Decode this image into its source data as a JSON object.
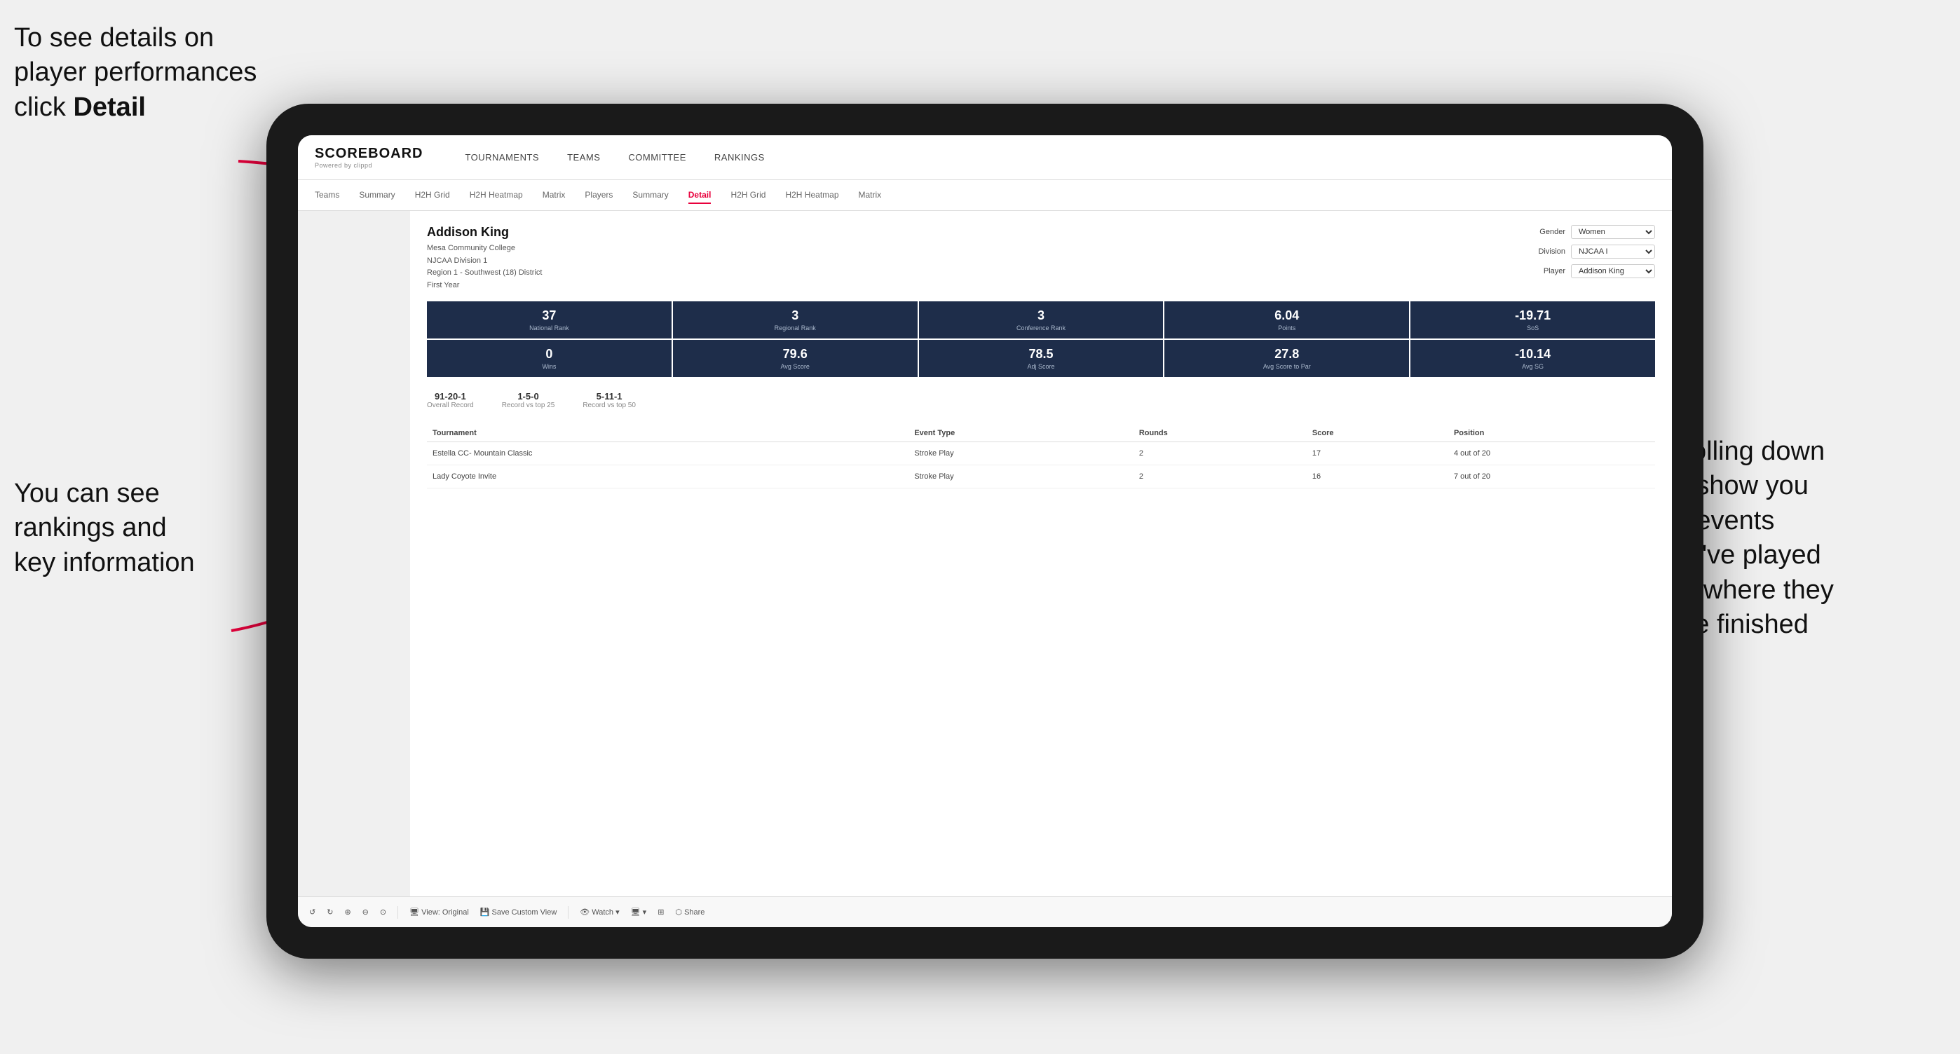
{
  "annotations": {
    "top_left": {
      "line1": "To see details on",
      "line2": "player performances",
      "line3_prefix": "click ",
      "line3_bold": "Detail"
    },
    "bottom_left": {
      "line1": "You can see",
      "line2": "rankings and",
      "line3": "key information"
    },
    "right": {
      "line1": "Scrolling down",
      "line2": "will show you",
      "line3": "the events",
      "line4": "they've played",
      "line5": "and where they",
      "line6": "have finished"
    }
  },
  "nav": {
    "logo": "SCOREBOARD",
    "logo_sub": "Powered by clippd",
    "items": [
      "TOURNAMENTS",
      "TEAMS",
      "COMMITTEE",
      "RANKINGS"
    ]
  },
  "sub_nav": {
    "items": [
      "Teams",
      "Summary",
      "H2H Grid",
      "H2H Heatmap",
      "Matrix",
      "Players",
      "Summary",
      "Detail",
      "H2H Grid",
      "H2H Heatmap",
      "Matrix"
    ],
    "active": "Detail"
  },
  "filters": {
    "gender_label": "Gender",
    "gender_value": "Women",
    "division_label": "Division",
    "division_value": "NJCAA I",
    "player_label": "Player",
    "player_value": "Addison King"
  },
  "player": {
    "name": "Addison King",
    "school": "Mesa Community College",
    "division": "NJCAA Division 1",
    "region": "Region 1 - Southwest (18) District",
    "year": "First Year"
  },
  "stats_row1": [
    {
      "value": "37",
      "label": "National Rank"
    },
    {
      "value": "3",
      "label": "Regional Rank"
    },
    {
      "value": "3",
      "label": "Conference Rank"
    },
    {
      "value": "6.04",
      "label": "Points"
    },
    {
      "value": "-19.71",
      "label": "SoS"
    }
  ],
  "stats_row2": [
    {
      "value": "0",
      "label": "Wins"
    },
    {
      "value": "79.6",
      "label": "Avg Score"
    },
    {
      "value": "78.5",
      "label": "Adj Score"
    },
    {
      "value": "27.8",
      "label": "Avg Score to Par"
    },
    {
      "value": "-10.14",
      "label": "Avg SG"
    }
  ],
  "records": [
    {
      "value": "91-20-1",
      "label": "Overall Record"
    },
    {
      "value": "1-5-0",
      "label": "Record vs top 25"
    },
    {
      "value": "5-11-1",
      "label": "Record vs top 50"
    }
  ],
  "table": {
    "headers": [
      "Tournament",
      "Event Type",
      "Rounds",
      "Score",
      "Position"
    ],
    "rows": [
      {
        "tournament": "Estella CC- Mountain Classic",
        "event_type": "Stroke Play",
        "rounds": "2",
        "score": "17",
        "position": "4 out of 20"
      },
      {
        "tournament": "Lady Coyote Invite",
        "event_type": "Stroke Play",
        "rounds": "2",
        "score": "16",
        "position": "7 out of 20"
      }
    ]
  },
  "toolbar": {
    "items": [
      "↺",
      "↻",
      "⊕",
      "⊖",
      "⊙",
      "View: Original",
      "Save Custom View",
      "Watch ▾",
      "🖥 ▾",
      "⊞",
      "Share"
    ]
  }
}
